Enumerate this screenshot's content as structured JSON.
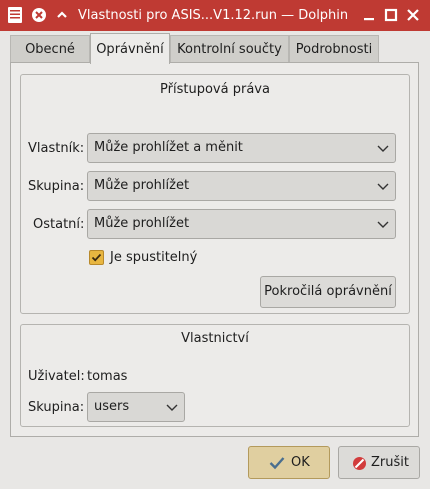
{
  "window": {
    "title": "Vlastnosti pro ASIS...V1.12.run — Dolphin"
  },
  "tabs": [
    {
      "label": "Obecné"
    },
    {
      "label": "Oprávnění"
    },
    {
      "label": "Kontrolní součty"
    },
    {
      "label": "Podrobnosti"
    }
  ],
  "access": {
    "title": "Přístupová práva",
    "owner_label": "Vlastník:",
    "owner_value": "Může prohlížet a měnit",
    "group_label": "Skupina:",
    "group_value": "Může prohlížet",
    "others_label": "Ostatní:",
    "others_value": "Může prohlížet",
    "executable_label": "Je spustitelný",
    "executable_checked": true,
    "advanced_button": "Pokročilá oprávnění"
  },
  "ownership": {
    "title": "Vlastnictví",
    "user_label": "Uživatel:",
    "user_value": "tomas",
    "group_label": "Skupina:",
    "group_value": "users"
  },
  "footer": {
    "ok_label": "OK",
    "cancel_label": "Zrušit"
  },
  "colors": {
    "titlebar": "#bf3a33",
    "checkbox": "#e8b640"
  }
}
